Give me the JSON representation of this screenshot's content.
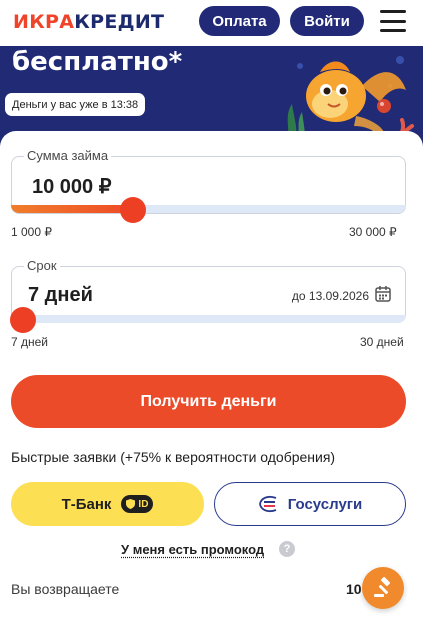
{
  "header": {
    "logo_part1": "ИКРА",
    "logo_part2": "КРЕДИТ",
    "pay_label": "Оплата",
    "login_label": "Войти",
    "menu_icon": "hamburger-icon"
  },
  "hero": {
    "title": "бесплатно*",
    "badge": "Деньги у вас уже в 13:38",
    "colors": {
      "background": "#202a75"
    }
  },
  "amount": {
    "label": "Сумма займа",
    "value": "10 000 ₽",
    "min_label": "1 000 ₽",
    "max_label": "30 000 ₽",
    "fill_fraction": 0.31
  },
  "term": {
    "label": "Срок",
    "value": "7 дней",
    "date_text": "до 13.09.2026",
    "min_label": "7 дней",
    "max_label": "30 дней",
    "fill_fraction": 0.0,
    "calendar_icon": "calendar-icon"
  },
  "cta": {
    "label": "Получить деньги",
    "color": "#ec4b2a"
  },
  "fast_apps": {
    "title": "Быстрые заявки (+75% к вероятности одобрения)",
    "tbank_label": "Т-Банк",
    "tbank_badge": "ID",
    "gos_label": "Госуслуги"
  },
  "promo": {
    "label": "У меня есть промокод",
    "help": "?"
  },
  "summary": {
    "return_label": "Вы возвращаете",
    "return_value": "10"
  },
  "fab": {
    "icon": "gavel-icon"
  }
}
